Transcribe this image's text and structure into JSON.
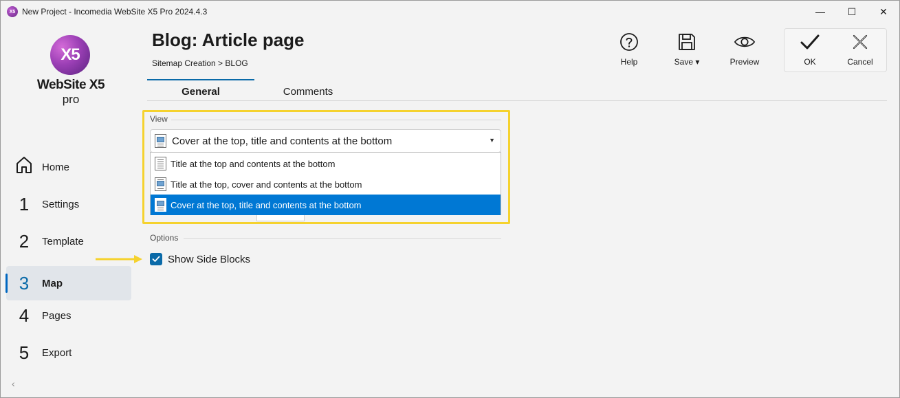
{
  "window": {
    "title": "New Project - Incomedia WebSite X5 Pro 2024.4.3",
    "app_icon_text": "X5",
    "minimize": "—",
    "maximize": "☐",
    "close": "✕"
  },
  "logo": {
    "mark": "X5",
    "name": "WebSite X5",
    "edition": "pro"
  },
  "sidebar": {
    "items": [
      {
        "num": "",
        "label": "Home",
        "icon": "home-icon"
      },
      {
        "num": "1",
        "label": "Settings"
      },
      {
        "num": "2",
        "label": "Template"
      },
      {
        "num": "3",
        "label": "Map",
        "active": true
      },
      {
        "num": "4",
        "label": "Pages"
      },
      {
        "num": "5",
        "label": "Export"
      }
    ],
    "collapse": "‹"
  },
  "header": {
    "title": "Blog: Article page",
    "breadcrumb": "Sitemap Creation > BLOG"
  },
  "toolbar": {
    "help": "Help",
    "save": "Save ▾",
    "preview": "Preview",
    "ok": "OK",
    "cancel": "Cancel"
  },
  "tabs": [
    {
      "label": "General",
      "active": true
    },
    {
      "label": "Comments"
    }
  ],
  "view": {
    "section_label": "View",
    "selected": "Cover at the top, title and contents at the bottom",
    "options": [
      "Title at the top and contents at the bottom",
      "Title at the top, cover and contents at the bottom",
      "Cover at the top, title and contents at the bottom"
    ]
  },
  "options": {
    "section_label": "Options",
    "show_side_blocks_label": "Show Side Blocks",
    "show_side_blocks_checked": true
  },
  "colors": {
    "accent": "#0a6aa8",
    "selection": "#0078d4",
    "highlight": "#f5d22e"
  }
}
